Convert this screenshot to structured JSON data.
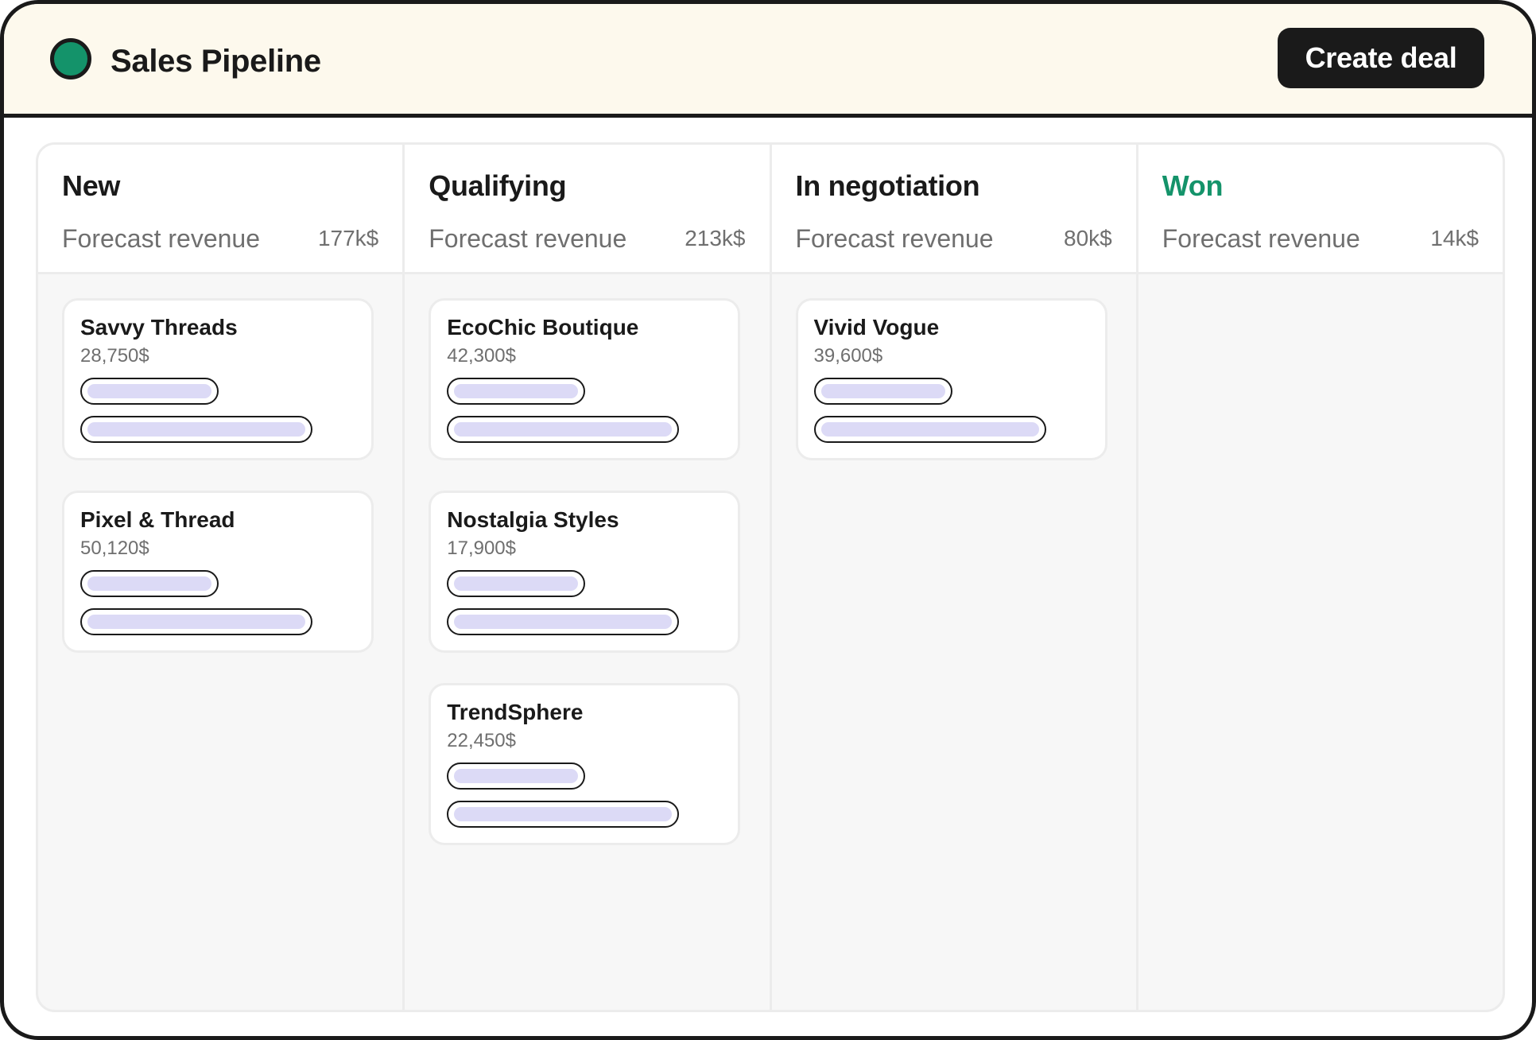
{
  "app": {
    "title": "Sales Pipeline"
  },
  "header": {
    "create_label": "Create deal"
  },
  "columns": [
    {
      "title": "New",
      "forecast_label": "Forecast revenue",
      "forecast_value": "177k$",
      "cards": [
        {
          "name": "Savvy Threads",
          "amount": "28,750$"
        },
        {
          "name": "Pixel & Thread",
          "amount": "50,120$"
        }
      ]
    },
    {
      "title": "Qualifying",
      "forecast_label": "Forecast revenue",
      "forecast_value": "213k$",
      "cards": [
        {
          "name": "EcoChic Boutique",
          "amount": "42,300$"
        },
        {
          "name": "Nostalgia Styles",
          "amount": "17,900$"
        },
        {
          "name": "TrendSphere",
          "amount": "22,450$"
        }
      ]
    },
    {
      "title": "In negotiation",
      "forecast_label": "Forecast revenue",
      "forecast_value": "80k$",
      "cards": [
        {
          "name": "Vivid Vogue",
          "amount": "39,600$"
        }
      ]
    },
    {
      "title": "Won",
      "forecast_label": "Forecast revenue",
      "forecast_value": "14k$",
      "cards": []
    }
  ],
  "colors": {
    "accent": "#14936a",
    "header_bg": "#fdf9ed",
    "placeholder_fill": "#dcdaf6",
    "dark": "#1a1a1a"
  },
  "icons": {
    "logo": "status-dot-icon"
  }
}
